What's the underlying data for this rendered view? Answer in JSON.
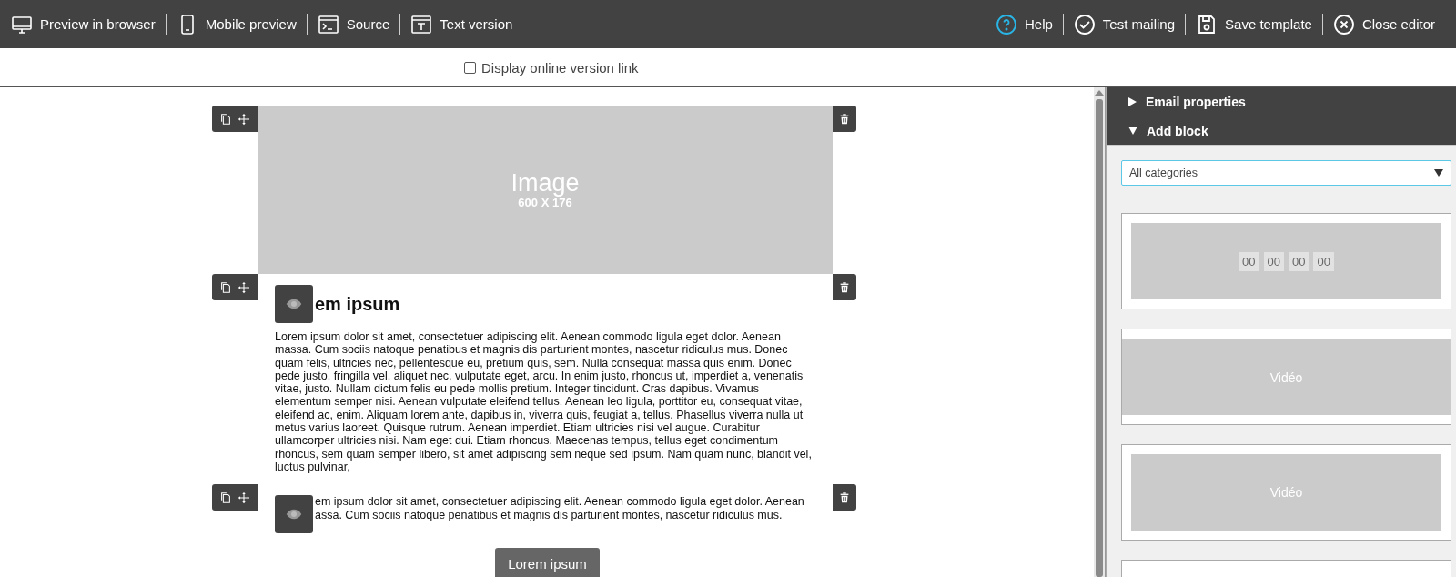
{
  "toolbar": {
    "left": [
      {
        "kind": "monitor",
        "label": "Preview in browser"
      },
      {
        "kind": "phone",
        "label": "Mobile preview"
      },
      {
        "kind": "source",
        "label": "Source"
      },
      {
        "kind": "text",
        "label": "Text version"
      }
    ],
    "right": [
      {
        "kind": "help",
        "label": "Help"
      },
      {
        "kind": "check",
        "label": "Test mailing"
      },
      {
        "kind": "save",
        "label": "Save template"
      },
      {
        "kind": "close",
        "label": "Close editor"
      }
    ]
  },
  "online_link": {
    "label": "Display online version link",
    "checked": false
  },
  "blocks": [
    {
      "kind": "image",
      "title": "Image",
      "size": "600 X 176"
    },
    {
      "kind": "text",
      "heading": "em ipsum",
      "paragraph": "Lorem ipsum dolor sit amet, consectetuer adipiscing elit. Aenean commodo ligula eget dolor. Aenean massa. Cum sociis natoque penatibus et magnis dis parturient montes, nascetur ridiculus mus. Donec quam felis, ultricies nec, pellentesque eu, pretium quis, sem. Nulla consequat massa quis enim. Donec pede justo, fringilla vel, aliquet nec, vulputate eget, arcu. In enim justo, rhoncus ut, imperdiet a, venenatis vitae, justo. Nullam dictum felis eu pede mollis pretium. Integer tincidunt. Cras dapibus. Vivamus elementum semper nisi. Aenean vulputate eleifend tellus. Aenean leo ligula, porttitor eu, consequat vitae, eleifend ac, enim. Aliquam lorem ante, dapibus in, viverra quis, feugiat a, tellus. Phasellus viverra nulla ut metus varius laoreet. Quisque rutrum. Aenean imperdiet. Etiam ultricies nisi vel augue. Curabitur ullamcorper ultricies nisi. Nam eget dui. Etiam rhoncus. Maecenas tempus, tellus eget condimentum rhoncus, sem quam semper libero, sit amet adipiscing sem neque sed ipsum. Nam quam nunc, blandit vel, luctus pulvinar,"
    },
    {
      "kind": "text_button",
      "paragraph": "em ipsum dolor sit amet, consectetuer adipiscing elit. Aenean commodo ligula eget dolor. Aenean assa. Cum sociis natoque penatibus et magnis dis parturient montes, nascetur ridiculus mus.",
      "button": "Lorem ipsum"
    }
  ],
  "panel": {
    "sections": [
      {
        "label": "Email properties",
        "expanded": false
      },
      {
        "label": "Add block",
        "expanded": true
      }
    ],
    "category_select": {
      "value": "All categories"
    },
    "templates": [
      {
        "kind": "countdown",
        "digits": [
          "00",
          "00",
          "00",
          "00"
        ]
      },
      {
        "kind": "video_wide",
        "label": "Vidéo"
      },
      {
        "kind": "video_framed",
        "label": "Vidéo"
      },
      {
        "kind": "empty"
      }
    ]
  }
}
